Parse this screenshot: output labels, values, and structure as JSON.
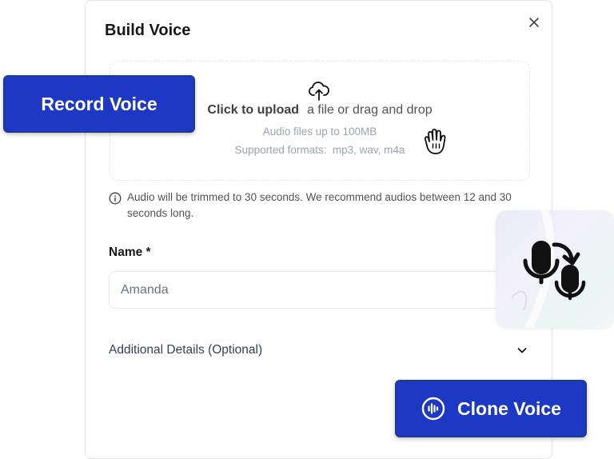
{
  "modal": {
    "title": "Build Voice",
    "close_icon": "close-icon",
    "dropzone": {
      "icon": "upload-cloud-icon",
      "click_text": "Click to upload",
      "rest_text": "a file or drag and drop",
      "size_hint": "Audio files up to 100MB",
      "formats_hint": "Supported formats:  mp3, wav, m4a",
      "cursor_icon": "hand-grab-cursor-icon"
    },
    "info": {
      "icon": "info-icon",
      "text": "Audio will be trimmed to 30 seconds. We recommend audios between 12 and 30 seconds long."
    },
    "name_field": {
      "label": "Name *",
      "value": "Amanda"
    },
    "additional_details": {
      "label": "Additional Details (Optional)",
      "icon": "chevron-down-icon"
    }
  },
  "overlays": {
    "record_button": {
      "label": "Record Voice"
    },
    "clone_button": {
      "label": "Clone Voice",
      "icon": "audio-wave-icon"
    },
    "voice_card": {
      "icon": "microphone-swap-icon"
    }
  },
  "colors": {
    "accent": "#1d39c4",
    "accent_border": "#1e3a8a",
    "text_primary": "#18181b",
    "text_muted": "#9ca3af",
    "border": "#e5e7eb"
  }
}
